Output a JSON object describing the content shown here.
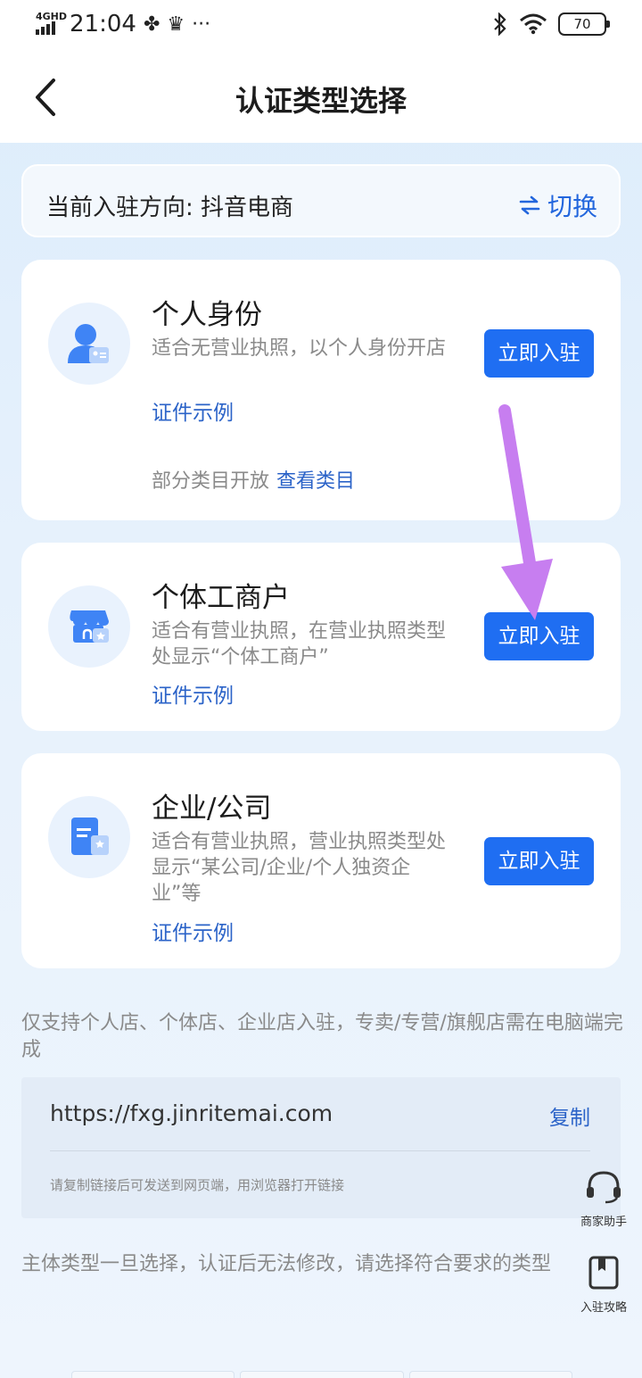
{
  "status_bar": {
    "network": "4GHD",
    "time": "21:04",
    "battery": "70",
    "more": "···"
  },
  "header": {
    "title": "认证类型选择"
  },
  "direction": {
    "text": "当前入驻方向: 抖音电商",
    "switch_label": "切换"
  },
  "cards": [
    {
      "title": "个人身份",
      "desc": "适合无营业执照，以个人身份开店",
      "link": "证件示例",
      "extra_text": "部分类目开放",
      "extra_link": "查看类目",
      "button": "立即入驻",
      "icon": "person-id-icon"
    },
    {
      "title": "个体工商户",
      "desc": "适合有营业执照，在营业执照类型处显示“个体工商户”",
      "link": "证件示例",
      "button": "立即入驻",
      "icon": "shop-icon"
    },
    {
      "title": "企业/公司",
      "desc": "适合有营业执照，营业执照类型处显示“某公司/企业/个人独资企业”等",
      "link": "证件示例",
      "button": "立即入驻",
      "icon": "company-doc-icon"
    }
  ],
  "notice": "仅支持个人店、个体店、企业店入驻，专卖/专营/旗舰店需在电脑端完成",
  "link_box": {
    "url": "https://fxg.jinritemai.com",
    "copy_label": "复制",
    "tip": "请复制链接后可发送到网页端，用浏览器打开链接"
  },
  "bottom_note": "主体类型一旦选择，认证后无法修改，请选择符合要求的类型",
  "float_buttons": {
    "assistant": "商家助手",
    "guide": "入驻攻略"
  },
  "colors": {
    "primary": "#1f6ef2",
    "link": "#2b63c8",
    "annotation_arrow": "#c77ef0"
  }
}
